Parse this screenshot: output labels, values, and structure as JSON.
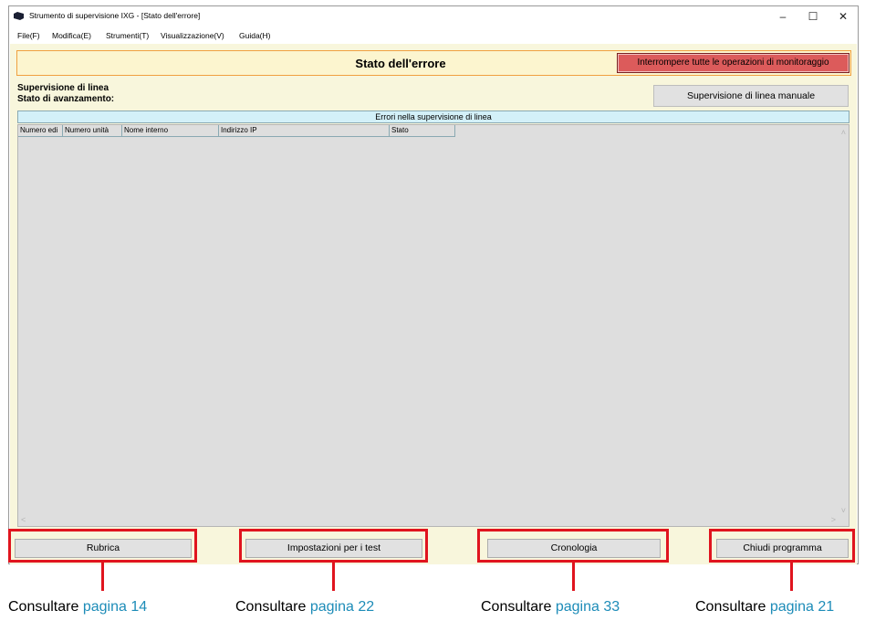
{
  "window": {
    "title": "Strumento di supervisione IXG - [Stato dell'errore]"
  },
  "menu": [
    "File(F)",
    "Modifica(E)",
    "Strumenti(T)",
    "Visualizzazione(V)",
    "Guida(H)"
  ],
  "status": {
    "title": "Stato dell'errore",
    "stop_button": "Interrompere tutte le operazioni di monitoraggio"
  },
  "supervision": {
    "line_label": "Supervisione di linea",
    "progress_label": "Stato di avanzamento:",
    "manual_button": "Supervisione di linea manuale"
  },
  "errors_table": {
    "header": "Errori nella supervisione di linea",
    "columns": [
      "Numero edi",
      "Numero unità",
      "Nome interno",
      "Indirizzo IP",
      "Stato"
    ]
  },
  "buttons": {
    "address_book": "Rubrica",
    "test_settings": "Impostazioni per i test",
    "history": "Cronologia",
    "close_program": "Chiudi programma"
  },
  "captions": [
    {
      "prefix": "Consultare ",
      "link": "pagina 14"
    },
    {
      "prefix": "Consultare ",
      "link": "pagina 22"
    },
    {
      "prefix": "Consultare ",
      "link": "pagina 33"
    },
    {
      "prefix": "Consultare ",
      "link": "pagina 21"
    }
  ],
  "colors": {
    "highlight": "#e0141e",
    "link": "#1d8cb8",
    "stop_button": "#dc5b5b"
  },
  "icons": [
    "app-icon",
    "minimize-icon",
    "maximize-icon",
    "close-icon"
  ]
}
